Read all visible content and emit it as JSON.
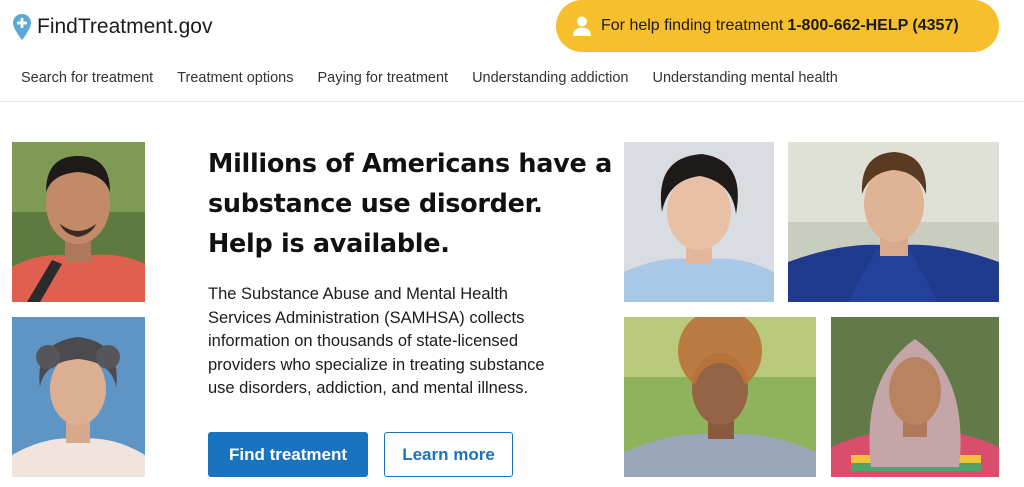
{
  "header": {
    "logo_text": "FindTreatment.gov",
    "helpline": {
      "lead": "For help finding treatment",
      "number": "1-800-662-HELP (4357)"
    }
  },
  "nav": [
    {
      "label": "Search for treatment"
    },
    {
      "label": "Treatment options"
    },
    {
      "label": "Paying for treatment"
    },
    {
      "label": "Understanding addiction"
    },
    {
      "label": "Understanding mental health"
    }
  ],
  "hero": {
    "headline_lines": [
      "Millions of Americans have a",
      "substance use disorder.",
      "Help is available."
    ],
    "description_lines": [
      "The Substance Abuse and Mental Health",
      "Services Administration (SAMHSA) collects",
      "information on thousands of state-licensed",
      "providers who specialize in treating substance",
      "use disorders, addiction, and mental illness."
    ],
    "primary_button": "Find treatment",
    "secondary_button": "Learn more"
  },
  "colors": {
    "accent_blue": "#1a73be",
    "helpline_yellow": "#f7bf2b",
    "logo_pin": "#5aa9d6"
  }
}
